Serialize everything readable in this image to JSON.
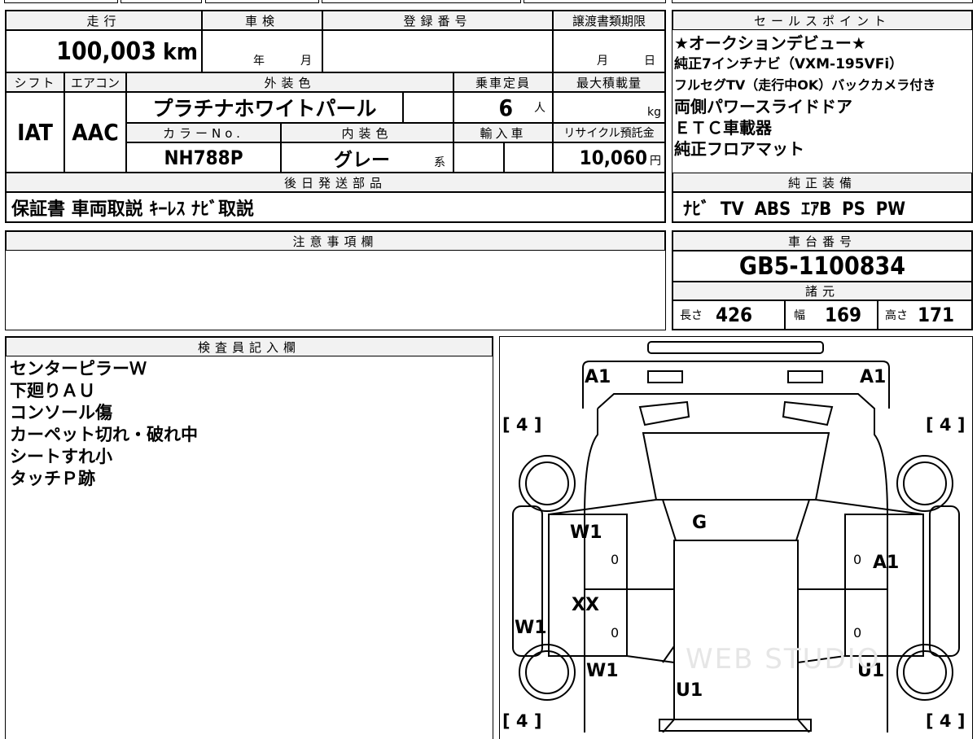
{
  "headers": {
    "mileage": "走行",
    "inspection": "車検",
    "registration": "登録番号",
    "transfer_deadline": "譲渡書類期限",
    "sales_points": "セールスポイント",
    "shift": "シフト",
    "aircon": "エアコン",
    "exterior_color": "外装色",
    "capacity": "乗車定員",
    "max_load": "最大積載量",
    "color_no": "カラーNo.",
    "interior_color": "内装色",
    "import": "輸入車",
    "recycle": "リサイクル預託金",
    "parts_later": "後日発送部品",
    "oem_equipment": "純正装備",
    "notes": "注意事項欄",
    "chassis": "車台番号",
    "specs": "諸元",
    "inspector": "検査員記入欄"
  },
  "vehicle": {
    "mileage": "100,003",
    "mileage_unit": "km",
    "inspection_year_unit": "年",
    "inspection_month_unit": "月",
    "deadline_month_unit": "月",
    "deadline_day_unit": "日",
    "shift": "IAT",
    "aircon": "AAC",
    "exterior_color": "プラチナホワイトパール",
    "capacity": "6",
    "capacity_unit": "人",
    "load_unit": "kg",
    "color_no": "NH788P",
    "interior_color": "グレー",
    "interior_suffix": "系",
    "recycle_fee": "10,060",
    "recycle_unit": "円",
    "chassis_no": "GB5-1100834",
    "length_label": "長さ",
    "length": "426",
    "width_label": "幅",
    "width": "169",
    "height_label": "高さ",
    "height": "171"
  },
  "sales_points": [
    "★オークションデビュー★",
    "純正7インチナビ（VXM-195VFi）",
    "フルセグTV（走行中OK）バックカメラ付き",
    "両側パワースライドドア",
    "ＥＴＣ車載器",
    "純正フロアマット"
  ],
  "parts_later": "保証書 車両取説 ｷｰﾚｽ ﾅﾋﾞ取説",
  "oem_equipment": "ﾅﾋﾞ TV ABS ｴｱB PS PW",
  "inspector_notes": [
    "センターピラーＷ",
    "下廻りＡＵ",
    "コンソール傷",
    "カーペット切れ・破れ中",
    "シートすれ小",
    "タッチＰ跡"
  ],
  "diagram": {
    "front_left": "A1",
    "front_right": "A1",
    "tire_fl": "4",
    "tire_fr": "4",
    "tire_rl": "4",
    "tire_rr": "4",
    "glass": "G",
    "left_front_door": "W1",
    "left_front_door_zero": "0",
    "left_rear_door": "XX",
    "left_rear_door_zero": "0",
    "left_sill": "W1",
    "left_rear_fender": "W1",
    "right_front_door": "A1",
    "right_front_door_zero": "0",
    "right_rear_door_zero": "0",
    "right_rear_fender": "U1",
    "rear_floor": "U1",
    "watermark": "WEB STUDIO"
  }
}
